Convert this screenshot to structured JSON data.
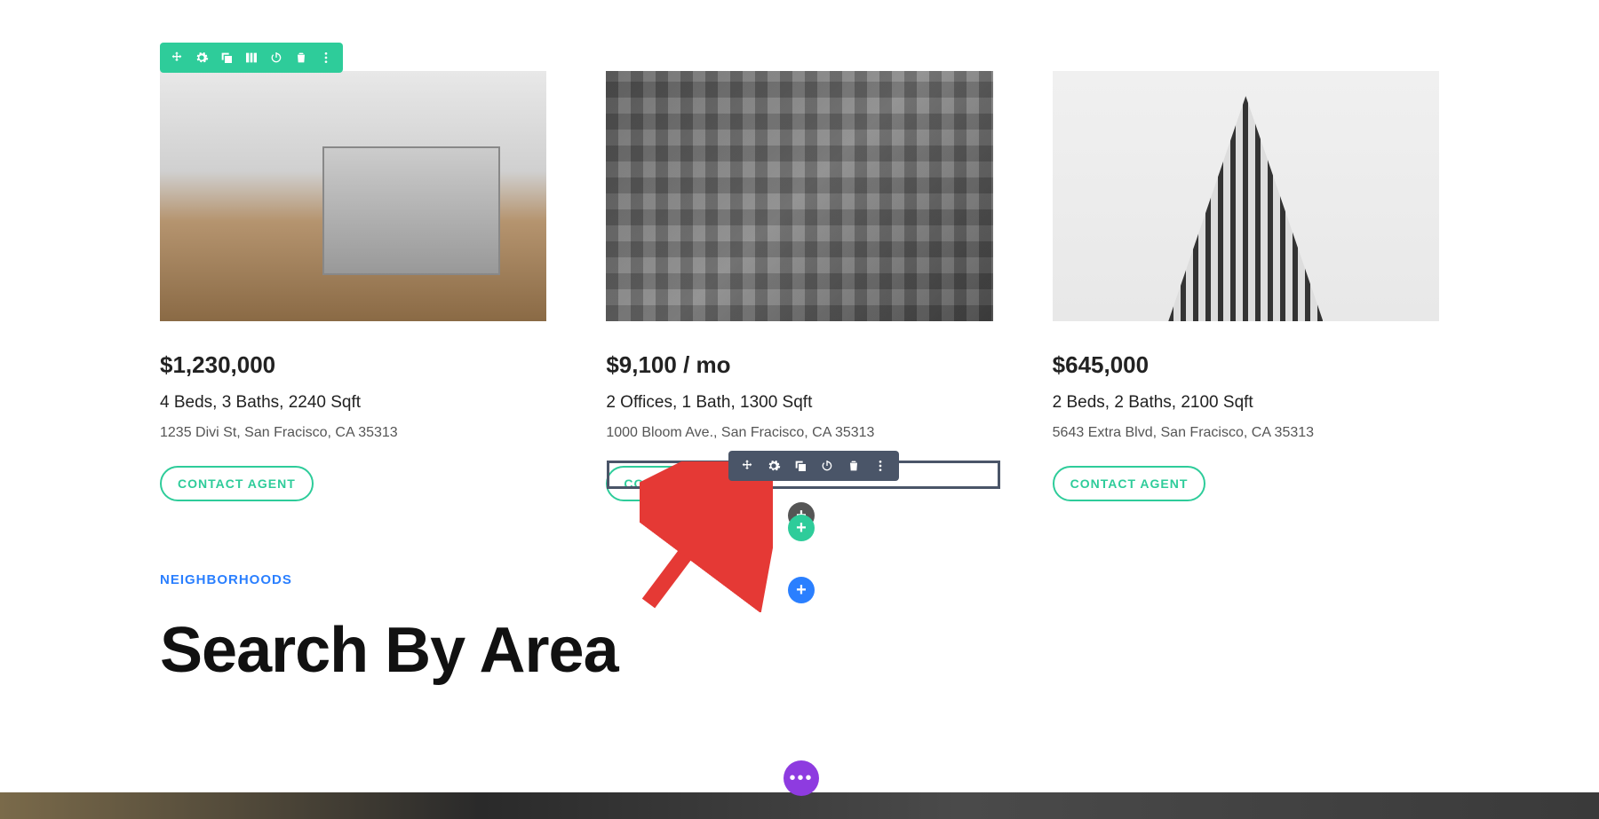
{
  "toolbar": {
    "color": "#2ecc9a"
  },
  "listings": [
    {
      "price": "$1,230,000",
      "specs": "4 Beds, 3 Baths, 2240 Sqft",
      "address": "1235 Divi St, San Fracisco, CA 35313",
      "cta": "CONTACT AGENT"
    },
    {
      "price": "$9,100 / mo",
      "specs": "2 Offices, 1 Bath, 1300 Sqft",
      "address": "1000 Bloom Ave., San Fracisco, CA 35313",
      "cta": "CONTACT AGENT"
    },
    {
      "price": "$645,000",
      "specs": "2 Beds, 2 Baths, 2100 Sqft",
      "address": "5643 Extra Blvd, San Fracisco, CA 35313",
      "cta": "CONTACT AGENT"
    }
  ],
  "section": {
    "label": "NEIGHBORHOODS",
    "heading": "Search By Area"
  },
  "colors": {
    "teal": "#2ecc9a",
    "darkToolbar": "#4a5568",
    "blue": "#2a7fff",
    "purple": "#8e3be0",
    "arrow": "#e53935"
  }
}
